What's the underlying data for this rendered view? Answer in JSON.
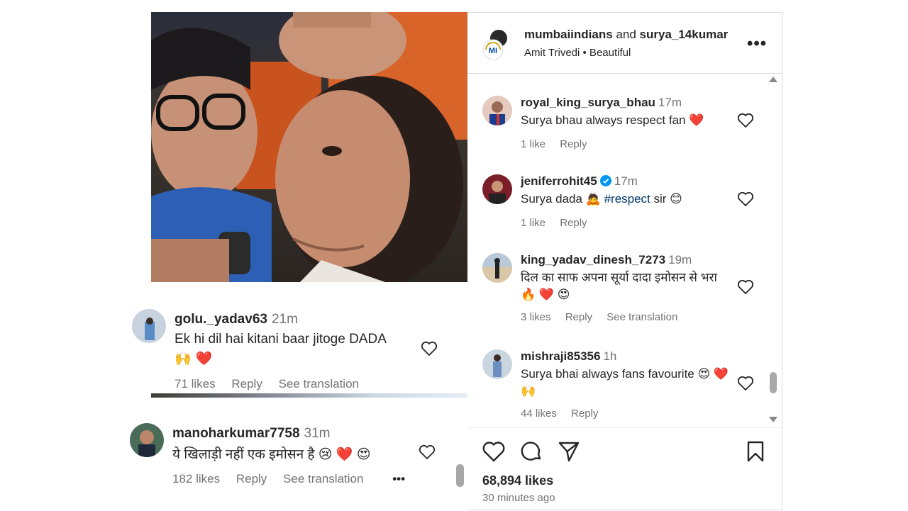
{
  "post": {
    "owner": "mumbaiindians",
    "connector": "and",
    "collaborator": "surya_14kumar",
    "audio": "Amit Trivedi • Beautiful",
    "more_label": "•••",
    "likes": "68,894 likes",
    "posted": "30 minutes ago"
  },
  "overlay_comments": [
    {
      "user": "golu._yadav63",
      "time": "21m",
      "text_line1": "Ek hi dil hai kitani baar jitoge DADA",
      "text_line2": "🙌 ❤️",
      "likes": "71 likes",
      "reply": "Reply",
      "translation": "See translation"
    },
    {
      "user": "manoharkumar7758",
      "time": "31m",
      "text": "ये खिलाड़ी नहीं एक इमोसन है 😢 ❤️ 😍",
      "likes": "182 likes",
      "reply": "Reply",
      "translation": "See translation",
      "more": "•••"
    }
  ],
  "comments": [
    {
      "user": "royal_king_surya_bhau",
      "time": "17m",
      "text": "Surya bhau always respect fan ❤️",
      "likes": "1 like",
      "reply": "Reply"
    },
    {
      "user": "jeniferrohit45",
      "time": "17m",
      "text_before": "Surya dada 🙇 ",
      "hashtag": "#respect",
      "text_after": " sir 😊",
      "likes": "1 like",
      "reply": "Reply"
    },
    {
      "user": "king_yadav_dinesh_7273",
      "time": "19m",
      "text": "दिल का साफ अपना सूर्या दादा इमोसन से भरा 🔥 ❤️ 😍",
      "likes": "3 likes",
      "reply": "Reply",
      "translation": "See translation"
    },
    {
      "user": "mishraji85356",
      "time": "1h",
      "text": "Surya bhai always fans favourite 😍 ❤️ 🙌",
      "likes": "44 likes",
      "reply": "Reply"
    }
  ],
  "icons": [
    "heart-icon",
    "comment-icon",
    "share-icon",
    "save-icon",
    "verified-icon",
    "more-icon"
  ],
  "colors": {
    "hashtag": "#00376b",
    "secondary_text": "#737373",
    "verified": "#0095f6",
    "heart_red": "#ed1c24"
  }
}
